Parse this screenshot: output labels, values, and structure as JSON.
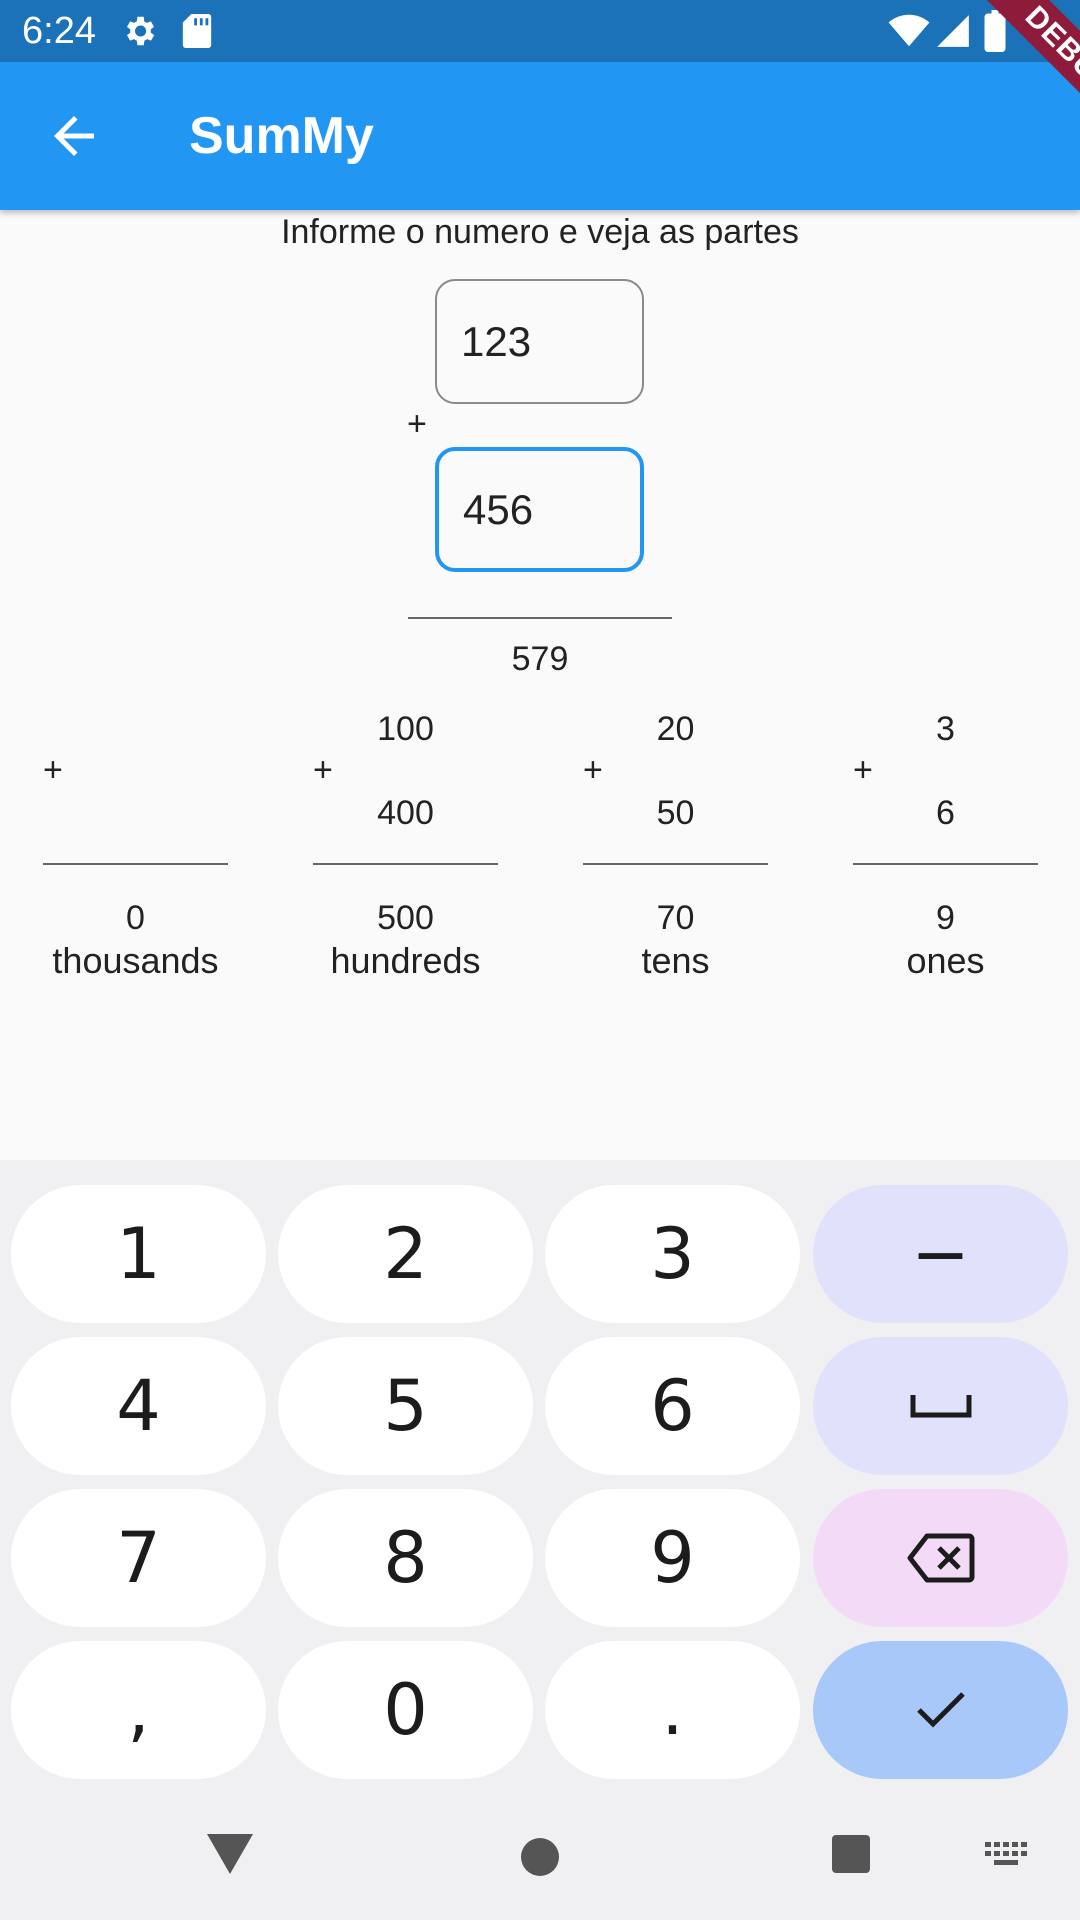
{
  "status_bar": {
    "time": "6:24"
  },
  "app_bar": {
    "title": "SumMy",
    "debug_label": "DEBUG"
  },
  "main": {
    "instruction": "Informe o numero e veja as partes",
    "first_number": "123",
    "second_number": "456",
    "plus_sign": "+",
    "total": "579"
  },
  "columns": [
    {
      "plus": "+",
      "top": "",
      "bottom": "",
      "result": "0",
      "label": "thousands"
    },
    {
      "plus": "+",
      "top": "100",
      "bottom": "400",
      "result": "500",
      "label": "hundreds"
    },
    {
      "plus": "+",
      "top": "20",
      "bottom": "50",
      "result": "70",
      "label": "tens"
    },
    {
      "plus": "+",
      "top": "3",
      "bottom": "6",
      "result": "9",
      "label": "ones"
    }
  ],
  "keyboard": {
    "keys": [
      "1",
      "2",
      "3",
      "4",
      "5",
      "6",
      "7",
      "8",
      "9",
      ",",
      "0",
      "."
    ],
    "minus": "−",
    "icons": [
      "space-icon",
      "backspace-icon",
      "checkmark-icon"
    ]
  },
  "nav_bar": {
    "icons": [
      "back-triangle-icon",
      "home-circle-icon",
      "recents-square-icon",
      "keyboard-icon"
    ]
  },
  "colors": {
    "app_bar": "#2196f3",
    "status_bar": "#1b72b8",
    "focus": "#2196f3"
  }
}
